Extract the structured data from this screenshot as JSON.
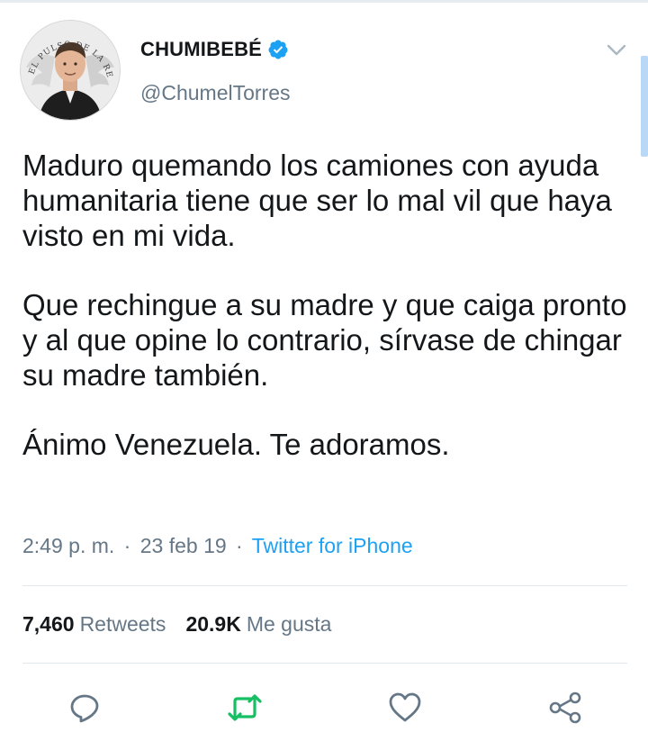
{
  "colors": {
    "text_primary": "#14171a",
    "text_secondary": "#657786",
    "link_blue": "#1da1f2",
    "retweet_green": "#17bf63",
    "divider": "#e1e8ed"
  },
  "tweet": {
    "display_name": "CHUMIBEBÉ",
    "verified_icon": "verified-badge",
    "handle": "@ChumelTorres",
    "avatar_seal_text": "EL PULSO DE LA REPUBLICA",
    "paragraphs": [
      "Maduro quemando los camiones con ayuda humanitaria tiene que ser lo mal vil que haya visto en mi vida.",
      "Que rechingue a su madre y que caiga pronto y al que opine lo contrario, sírvase de chingar su madre también.",
      "Ánimo Venezuela. Te adoramos."
    ],
    "time": "2:49 p. m.",
    "separator": "·",
    "date": "23 feb 19",
    "source": "Twitter for iPhone"
  },
  "stats": {
    "retweets_count": "7,460",
    "retweets_label": "Retweets",
    "likes_count": "20.9K",
    "likes_label": "Me gusta"
  },
  "actions": {
    "reply_icon": "reply-icon",
    "retweet_icon": "retweet-icon",
    "like_icon": "heart-icon",
    "share_icon": "share-icon"
  }
}
